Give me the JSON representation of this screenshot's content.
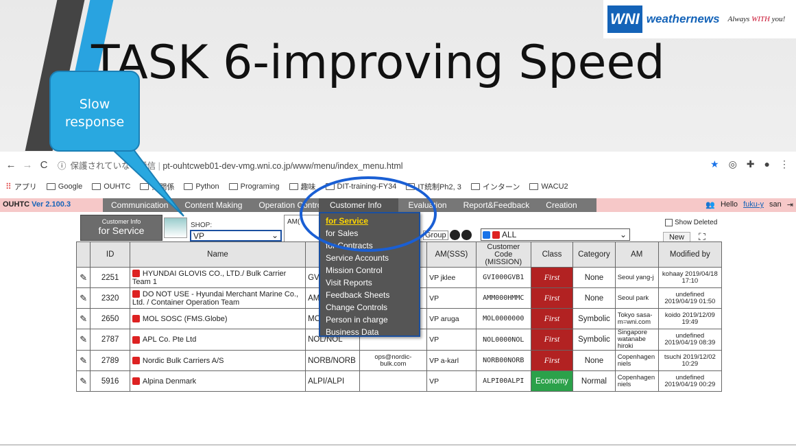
{
  "slide": {
    "title": "TASK 6-improving Speed",
    "logo": {
      "mark": "WNI",
      "name": "weathernews",
      "tagline_pre": "Always ",
      "tagline_accent": "WITH",
      "tagline_post": " you!"
    },
    "callout": "Slow response"
  },
  "browser": {
    "url_security": "保護されていない通信",
    "url": "pt-ouhtcweb01-dev-vmg.wni.co.jp/www/menu/index_menu.html",
    "bookmarks": [
      "アプリ",
      "Google",
      "OUHTC",
      "業関係",
      "Python",
      "Programing",
      "趣味",
      "DIT-training-FY34",
      "IT統制Ph2, 3",
      "インターン",
      "WACU2"
    ]
  },
  "app": {
    "brand": "OUHTC",
    "version": "Ver 2.100.3",
    "menu": [
      "Communication",
      "Content Making",
      "Operation Control",
      "Customer Info",
      "Evaluation",
      "Report&Feedback",
      "Creation"
    ],
    "greeting": "Hello",
    "user": "fuku-y",
    "user_suffix": "san",
    "customer_info_small": "Customer Info",
    "customer_info_big": "for Service",
    "shop_label": "SHOP:",
    "shop_value": "VP",
    "am_label": "AM(",
    "group_label": "Group",
    "all_label": "ALL",
    "show_deleted": "Show Deleted",
    "new_button": "New",
    "dropdown": {
      "header": "Customer Info",
      "items": [
        "for Service",
        "for Sales",
        "for Contracts",
        "Service Accounts",
        "Mission Control",
        "Visit Reports",
        "Feedback Sheets",
        "Change Controls",
        "Person in charge",
        "Business Data"
      ]
    }
  },
  "table": {
    "headers": [
      "",
      "ID",
      "Name",
      "N",
      "",
      "AM(SSS)",
      "Customer Code (MISSION)",
      "Class",
      "Category",
      "AM",
      "Modified by"
    ],
    "rows": [
      {
        "id": "2251",
        "name": "HYUNDAI GLOVIS CO., LTD./ Bulk Carrier Team 1",
        "n": "GVI/",
        "email": "s.ne",
        "am_sss": "VP jklee",
        "code": "GVI000GVB1",
        "class": "First",
        "category": "None",
        "am": "Seoul yang-j",
        "modified": "kohaay 2019/04/18 17:10"
      },
      {
        "id": "2320",
        "name": "DO NOT USE - Hyundai Merchant Marine Co., Ltd. / Container Operation Team",
        "n": "AMM",
        "email": "",
        "am_sss": "VP",
        "code": "AMM000HMMC",
        "class": "First",
        "category": "None",
        "am": "Seoul park",
        "modified": "undefined 2019/04/19 01:50"
      },
      {
        "id": "2650",
        "name": "MOL SOSC (FMS.Globe)",
        "n": "MOL",
        "email": "",
        "am_sss": "VP aruga",
        "code": "MOL0000000",
        "class": "First",
        "category": "Symbolic",
        "am": "Tokyo sasa-m=wni.com",
        "modified": "koido 2019/12/09 19:49"
      },
      {
        "id": "2787",
        "name": "APL Co. Pte Ltd",
        "n": "NOL/NOL",
        "email": "",
        "am_sss": "VP",
        "code": "NOL0000NOL",
        "class": "First",
        "category": "Symbolic",
        "am": "Singapore watanabe hiroki",
        "modified": "undefined 2019/04/19 08:39"
      },
      {
        "id": "2789",
        "name": "Nordic Bulk Carriers A/S",
        "n": "NORB/NORB",
        "email": "ops@nordic-bulk.com",
        "am_sss": "VP a-karl",
        "code": "NORB00NORB",
        "class": "First",
        "category": "None",
        "am": "Copenhagen niels",
        "modified": "tsuchi 2019/12/02 10:29"
      },
      {
        "id": "5916",
        "name": "Alpina Denmark",
        "n": "ALPI/ALPI",
        "email": "",
        "am_sss": "VP",
        "code": "ALPI00ALPI",
        "class": "Economy",
        "category": "Normal",
        "am": "Copenhagen niels",
        "modified": "undefined 2019/04/19 00:29"
      }
    ]
  },
  "colors": {
    "accent": "#29a8e0",
    "first": "#b22222",
    "economy": "#2ba14a",
    "highlight": "#1a5fd4"
  }
}
